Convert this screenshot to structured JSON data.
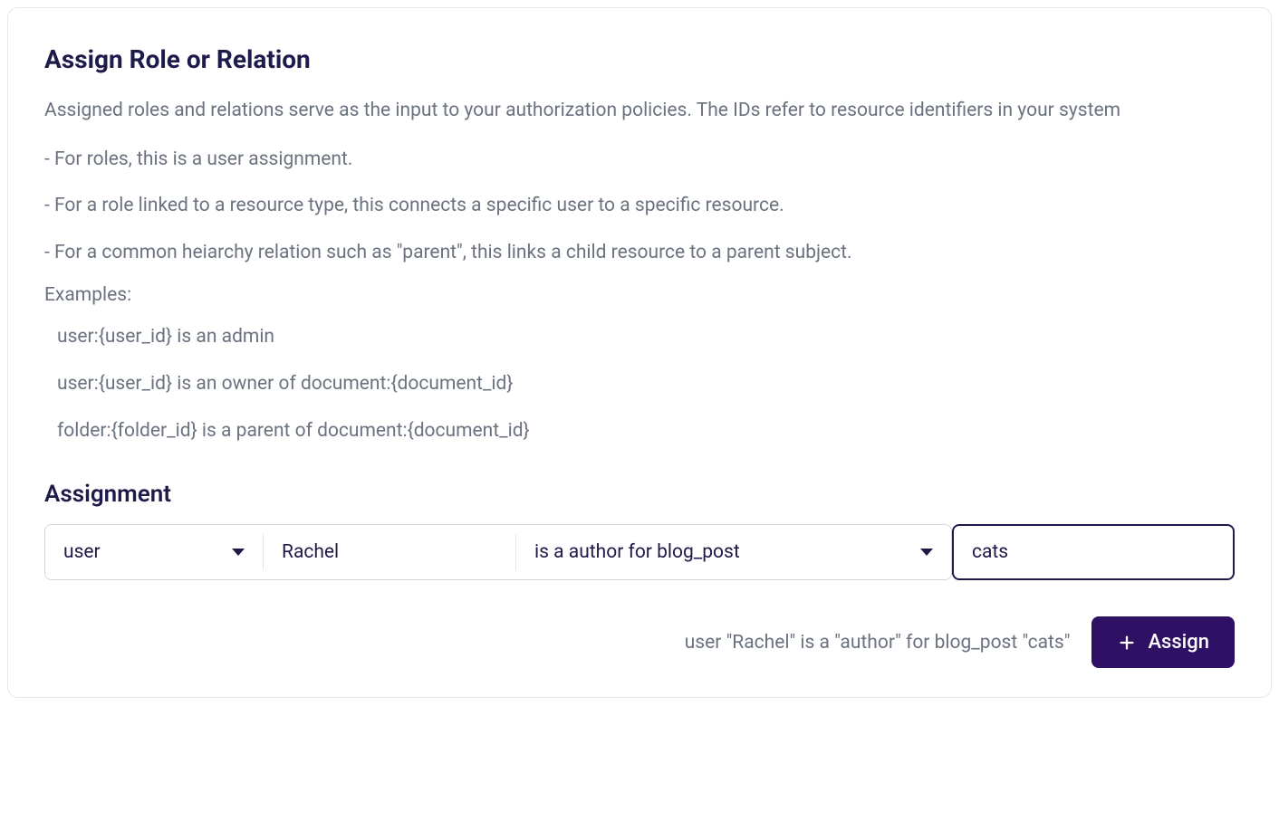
{
  "card": {
    "title": "Assign Role or Relation",
    "description": "Assigned roles and relations serve as the input to your authorization policies. The IDs refer to resource identifiers in your system",
    "bullets": [
      "- For roles, this is a user assignment.",
      "- For a role linked to a resource type, this connects a specific user to a specific resource.",
      "- For a common heiarchy relation such as \"parent\", this links a child resource to a parent subject."
    ],
    "examples_label": "Examples:",
    "examples": [
      "user:{user_id} is an admin",
      "user:{user_id} is an owner of document:{document_id}",
      "folder:{folder_id} is a parent of document:{document_id}"
    ]
  },
  "assignment": {
    "section_title": "Assignment",
    "subject_type": "user",
    "subject_id": "Rachel",
    "relation": "is a author for blog_post",
    "resource_id": "cats"
  },
  "footer": {
    "summary": "user \"Rachel\" is a \"author\" for blog_post \"cats\"",
    "button_label": "Assign"
  }
}
